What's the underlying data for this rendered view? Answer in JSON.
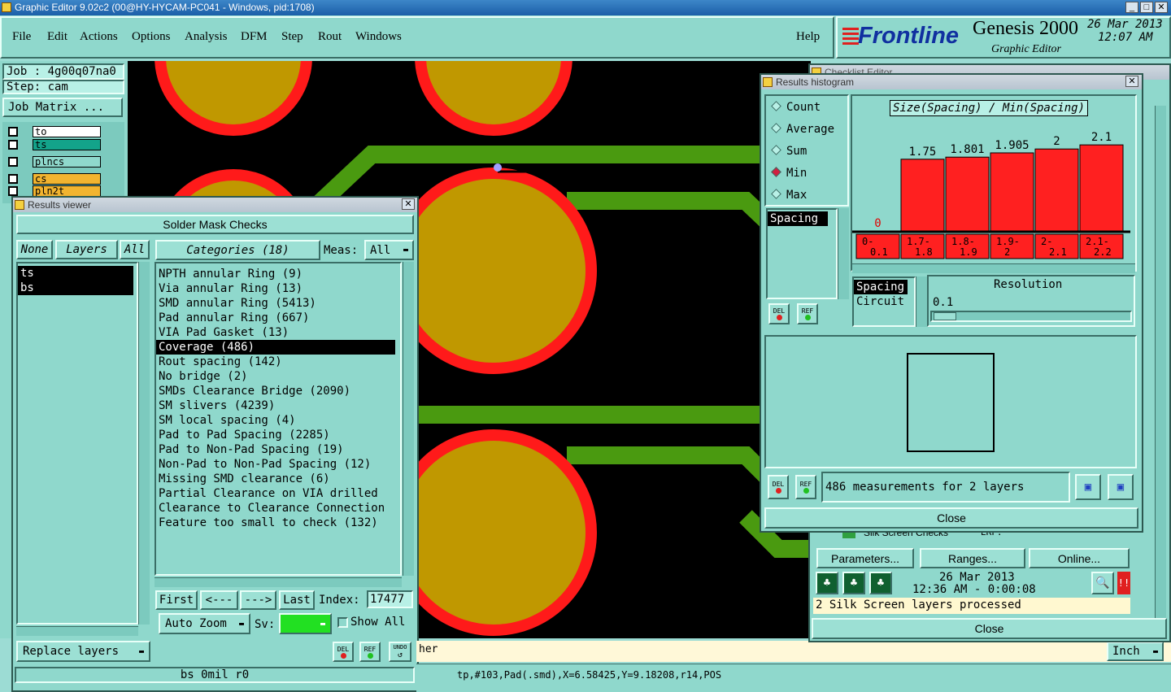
{
  "window": {
    "title": "Graphic Editor 9.02c2 (00@HY-HYCAM-PC041 - Windows, pid:1708)"
  },
  "menu": {
    "items": [
      "File",
      "Edit",
      "Actions",
      "Options",
      "Analysis",
      "DFM",
      "Step",
      "Rout",
      "Windows"
    ],
    "help": "Help"
  },
  "brand": {
    "logo": "Frontline",
    "product": "Genesis 2000",
    "subtitle": "Graphic Editor",
    "date": "26 Mar 2013",
    "time": "12:07 AM"
  },
  "left_panel": {
    "job": "Job : 4g00q07na0",
    "step": "Step: cam",
    "job_matrix": "Job Matrix ...",
    "layers": [
      {
        "name": "to",
        "color": "#ffffff"
      },
      {
        "name": "ts",
        "color": "#13a38a"
      },
      {
        "name": "plncs",
        "color": "#8fd8cc"
      },
      {
        "name": "cs",
        "color": "#f2b430"
      },
      {
        "name": "pln2t",
        "color": "#f2b430"
      }
    ]
  },
  "results_viewer": {
    "title": "Results viewer",
    "header": "Solder Mask Checks",
    "none_btn": "None",
    "layers_btn": "Layers",
    "all_btn": "All",
    "layers": [
      "ts",
      "bs"
    ],
    "categories_btn": "Categories (18)",
    "meas_label": "Meas:",
    "meas_value": "All",
    "categories": [
      "NPTH annular Ring (9)",
      "Via annular Ring (13)",
      "SMD annular Ring (5413)",
      "Pad annular Ring (667)",
      "VIA Pad Gasket (13)",
      "Coverage (486)",
      "Rout spacing (142)",
      "No bridge (2)",
      "SMDs Clearance Bridge (2090)",
      "SM slivers (4239)",
      "SM local spacing (4)",
      "Pad to Pad Spacing (2285)",
      "Pad to Non-Pad Spacing (19)",
      "Non-Pad to Non-Pad Spacing (12)",
      "Missing SMD clearance (6)",
      "Partial Clearance on VIA drilled",
      "Clearance to Clearance Connection",
      "Feature too small to check (132)"
    ],
    "selected_category": "Coverage (486)",
    "first": "First",
    "prev": "<---",
    "next": "--->",
    "last": "Last",
    "index_label": "Index:",
    "index_value": "17477",
    "auto_zoom": "Auto Zoom",
    "sv_label": "Sv:",
    "show_all": "Show All",
    "replace_layers": "Replace layers",
    "del": "DEL",
    "ref": "REF",
    "undo": "UNDO",
    "status": "bs 0mil r0"
  },
  "results_histogram": {
    "title": "Results histogram",
    "modes": [
      "Count",
      "Average",
      "Sum",
      "Min",
      "Max"
    ],
    "selected_mode": "Min",
    "chart_title": "Size(Spacing) / Min(Spacing)",
    "measure_list": [
      "Spacing"
    ],
    "resolution_list": [
      "Spacing",
      "Circuit"
    ],
    "resolution_label": "Resolution",
    "resolution_value": "0.1",
    "del": "DEL",
    "ref": "REF",
    "measurements": "486 measurements for 2 layers",
    "close": "Close"
  },
  "chart_data": {
    "type": "bar",
    "title": "Size(Spacing) / Min(Spacing)",
    "categories": [
      "0-0.1",
      "1.7-1.8",
      "1.8-1.9",
      "1.9-2",
      "2-2.1",
      "2.1-2.2"
    ],
    "values": [
      0,
      1.75,
      1.801,
      1.905,
      2,
      2.1
    ],
    "value_labels": [
      "0",
      "1.75",
      "1.801",
      "1.905",
      "2",
      "2.1"
    ],
    "ylim": [
      0,
      2.3
    ],
    "bar_color": "#ff2020"
  },
  "checklist": {
    "title": "Checklist Editor",
    "row_label": "Silk Screen Checks",
    "row_state": "ERF:",
    "parameters": "Parameters...",
    "ranges": "Ranges...",
    "online": "Online...",
    "date": "26 Mar 2013",
    "time": "12:36 AM - 0:00:08",
    "message": "2 Silk Screen layers processed",
    "close": "Close"
  },
  "status_bar": {
    "coords": "tp,#103,Pad(.smd),X=6.58425,Y=9.18208,r14,POS",
    "fragment": "her",
    "units": "Inch"
  },
  "colors": {
    "teal": "#8fd8cc",
    "pad": "#c09800",
    "pad_ring": "#ff1a1a",
    "trace": "#4a9a10",
    "canvas": "#000000"
  }
}
